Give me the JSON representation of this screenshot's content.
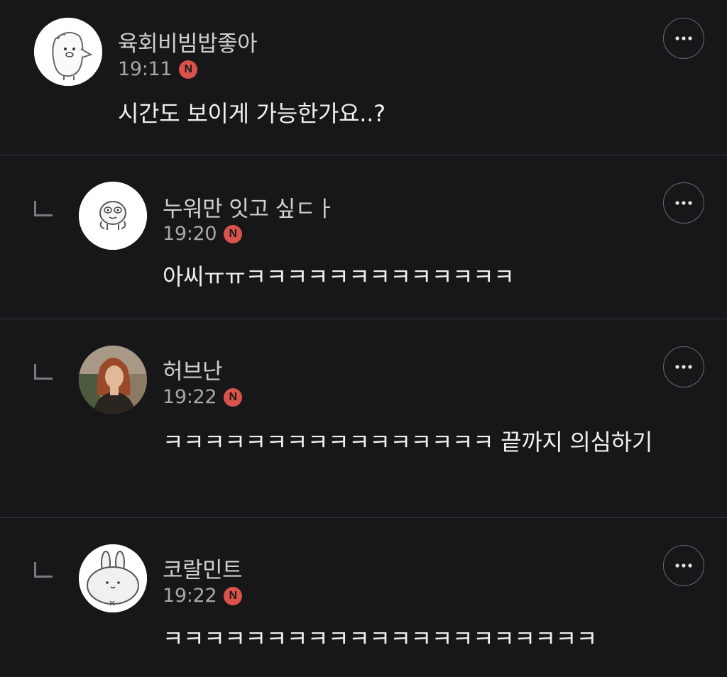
{
  "comments": [
    {
      "nickname": "육회비빔밥좋아",
      "time": "19:11",
      "badge": "N",
      "text": "시간도 보이게 가능한가요..?",
      "avatar_icon": "sticker-character-icon",
      "is_reply": false
    },
    {
      "nickname": "누워만 잇고 싶ㄷㅏ",
      "time": "19:20",
      "badge": "N",
      "text": "아씨ㅠㅠㅋㅋㅋㅋㅋㅋㅋㅋㅋㅋㅋㅋㅋ",
      "avatar_icon": "sticker-creature-icon",
      "is_reply": true
    },
    {
      "nickname": "허브난",
      "time": "19:22",
      "badge": "N",
      "text": "ㅋㅋㅋㅋㅋㅋㅋㅋㅋㅋㅋㅋㅋㅋㅋㅋ 끝까지 의심하기",
      "avatar_icon": "photo-avatar",
      "is_reply": true
    },
    {
      "nickname": "코랄민트",
      "time": "19:22",
      "badge": "N",
      "text": "ㅋㅋㅋㅋㅋㅋㅋㅋㅋㅋㅋㅋㅋㅋㅋㅋㅋㅋㅋㅋㅋ",
      "avatar_icon": "bunny-sticker-icon",
      "is_reply": true
    }
  ],
  "more_icon": "more-dots-icon",
  "reply_icon": "reply-indent-icon",
  "colors": {
    "background": "#17171a",
    "divider": "#34343a",
    "new_badge": "#d9534a",
    "nickname": "#cfcfcf",
    "time": "#a8a8a8",
    "text": "#f0f0f0"
  }
}
